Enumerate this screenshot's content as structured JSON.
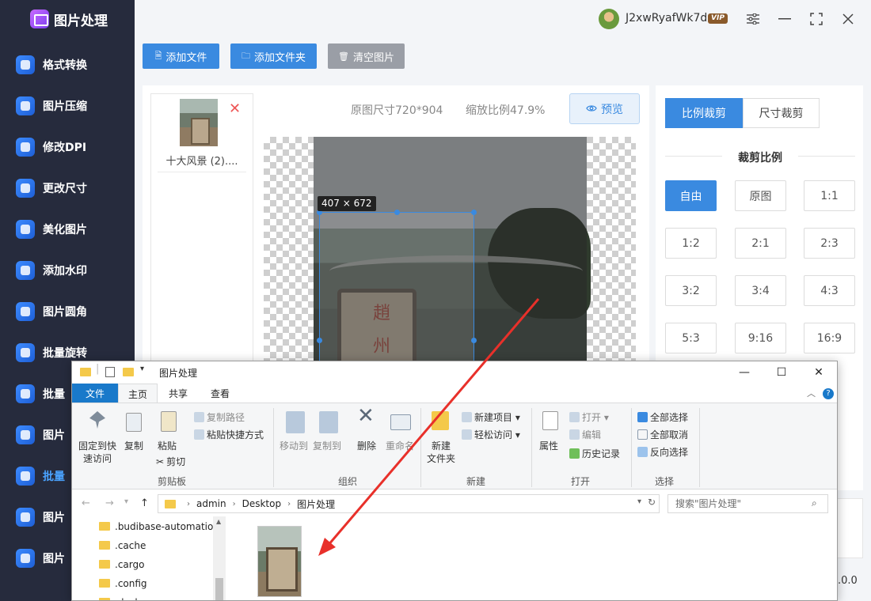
{
  "app": {
    "title": "图片处理"
  },
  "sidebar": {
    "items": [
      {
        "label": "格式转换",
        "icon": "format-convert-icon"
      },
      {
        "label": "图片压缩",
        "icon": "compress-icon"
      },
      {
        "label": "修改DPI",
        "icon": "dpi-icon"
      },
      {
        "label": "更改尺寸",
        "icon": "resize-icon"
      },
      {
        "label": "美化图片",
        "icon": "beautify-icon"
      },
      {
        "label": "添加水印",
        "icon": "watermark-icon"
      },
      {
        "label": "图片圆角",
        "icon": "rounded-corner-icon"
      },
      {
        "label": "批量旋转",
        "icon": "rotate-icon"
      },
      {
        "label": "批量",
        "icon": "batch-icon"
      },
      {
        "label": "图片",
        "icon": "image-icon"
      },
      {
        "label": "批量",
        "icon": "crop-icon"
      },
      {
        "label": "图片",
        "icon": "split-icon"
      },
      {
        "label": "图片",
        "icon": "layers-icon"
      }
    ]
  },
  "user": {
    "name": "J2xwRyafWk7d",
    "badge": "VIP"
  },
  "window_controls": {
    "settings": "⚙",
    "minimize": "—",
    "maximize": "⛶",
    "close": "✕"
  },
  "toolbar": {
    "add_file": "添加文件",
    "add_folder": "添加文件夹",
    "clear": "清空图片"
  },
  "file_list": [
    {
      "name": "十大风景 (2)...."
    }
  ],
  "preview": {
    "original_size": "原图尺寸720*904",
    "zoom": "缩放比例47.9%",
    "preview_label": "预览",
    "crop_dims": "407 × 672",
    "stone_chars": [
      "趙",
      "州"
    ]
  },
  "crop_panel": {
    "tabs": [
      "比例裁剪",
      "尺寸裁剪"
    ],
    "section_title": "裁剪比例",
    "ratios": [
      "自由",
      "原图",
      "1:1",
      "1:2",
      "2:1",
      "2:3",
      "3:2",
      "3:4",
      "4:3",
      "5:3",
      "9:16",
      "16:9"
    ],
    "active_ratio": "自由"
  },
  "version_suffix": ".0.0",
  "explorer": {
    "title": "图片处理",
    "tabs": {
      "file": "文件",
      "home": "主页",
      "share": "共享",
      "view": "查看"
    },
    "ribbon": {
      "pin": "固定到快\n速访问",
      "copy": "复制",
      "paste": "粘贴",
      "copy_path": "复制路径",
      "paste_shortcut": "粘贴快捷方式",
      "cut": "剪切",
      "clipboard_group": "剪贴板",
      "move_to": "移动到",
      "copy_to": "复制到",
      "delete": "删除",
      "rename": "重命名",
      "organize_group": "组织",
      "new_folder": "新建\n文件夹",
      "new_item": "新建项目",
      "easy_access": "轻松访问",
      "new_group": "新建",
      "properties": "属性",
      "open": "打开",
      "edit": "编辑",
      "history": "历史记录",
      "open_group": "打开",
      "select_all": "全部选择",
      "select_none": "全部取消",
      "invert_selection": "反向选择",
      "select_group": "选择"
    },
    "address": [
      "admin",
      "Desktop",
      "图片处理"
    ],
    "search_placeholder": "搜索\"图片处理\"",
    "tree": [
      ".budibase-automation",
      ".cache",
      ".cargo",
      ".config",
      ".dock"
    ]
  }
}
